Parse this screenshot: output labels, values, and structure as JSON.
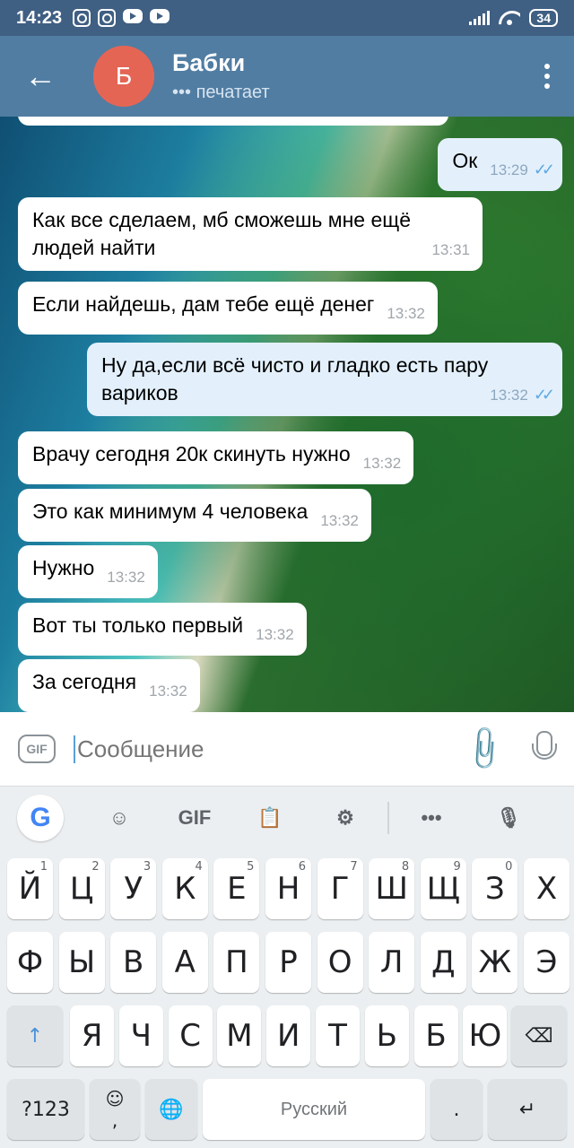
{
  "status_bar": {
    "time": "14:23",
    "battery": "34"
  },
  "header": {
    "back_icon": "arrow-left-icon",
    "avatar_letter": "Б",
    "title": "Бабки",
    "status": "••• печатает",
    "menu_icon": "more-vertical-icon"
  },
  "messages": [
    {
      "dir": "out",
      "text": "Ок",
      "time": "13:29",
      "read": true
    },
    {
      "dir": "in",
      "text": "Как все сделаем, мб сможешь мне ещё людей найти",
      "time": "13:31"
    },
    {
      "dir": "in",
      "text": "Если найдешь, дам тебе ещё денег",
      "time": "13:32"
    },
    {
      "dir": "out",
      "text": "Ну да,если всё чисто и гладко есть пару вариков",
      "time": "13:32",
      "read": true
    },
    {
      "dir": "in",
      "text": "Врачу сегодня 20к скинуть нужно",
      "time": "13:32"
    },
    {
      "dir": "in",
      "text": "Это как минимум 4 человека",
      "time": "13:32"
    },
    {
      "dir": "in",
      "text": "Нужно",
      "time": "13:32"
    },
    {
      "dir": "in",
      "text": "Вот ты только первый",
      "time": "13:32"
    },
    {
      "dir": "in",
      "text": "За сегодня",
      "time": "13:32"
    }
  ],
  "input": {
    "gif_label": "GIF",
    "placeholder": "Сообщение"
  },
  "keyboard": {
    "toolbar_gif": "GIF",
    "row1": [
      [
        "Й",
        "1"
      ],
      [
        "Ц",
        "2"
      ],
      [
        "У",
        "3"
      ],
      [
        "К",
        "4"
      ],
      [
        "Е",
        "5"
      ],
      [
        "Н",
        "6"
      ],
      [
        "Г",
        "7"
      ],
      [
        "Ш",
        "8"
      ],
      [
        "Щ",
        "9"
      ],
      [
        "З",
        "0"
      ],
      [
        "Х",
        ""
      ]
    ],
    "row2": [
      "Ф",
      "Ы",
      "В",
      "А",
      "П",
      "Р",
      "О",
      "Л",
      "Д",
      "Ж",
      "Э"
    ],
    "row3": [
      "Я",
      "Ч",
      "С",
      "М",
      "И",
      "Т",
      "Ь",
      "Б",
      "Ю"
    ],
    "symbols_label": "?123",
    "emoji_sub": ",",
    "space_label": "Русский",
    "period_label": "."
  }
}
